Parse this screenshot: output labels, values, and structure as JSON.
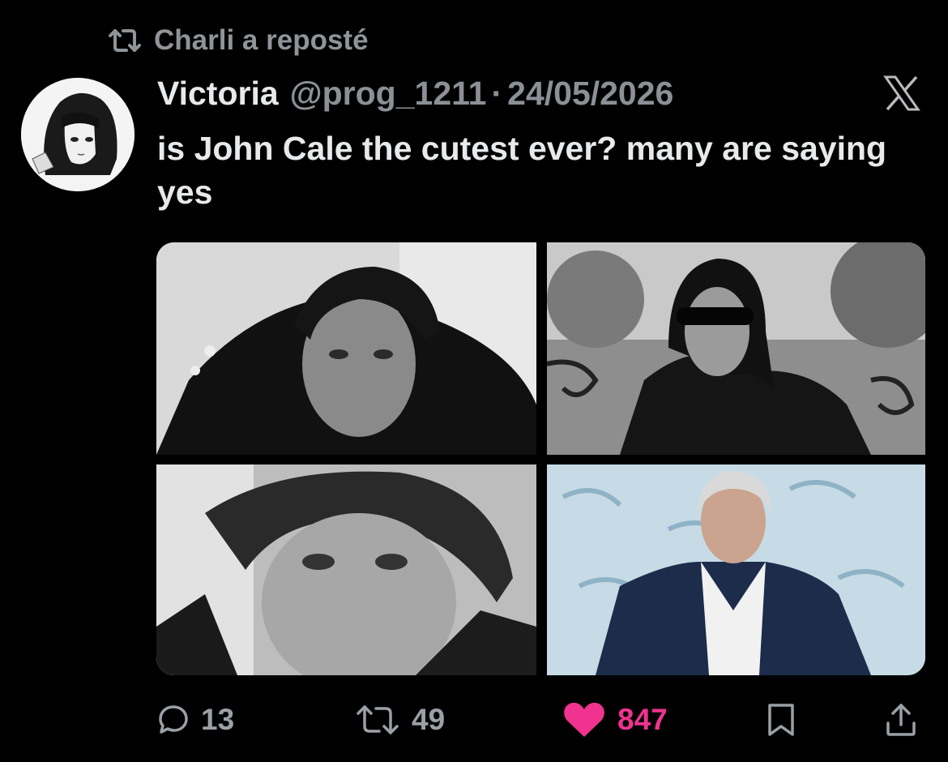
{
  "repost": {
    "icon": "repost-icon",
    "text": "Charli a reposté"
  },
  "tweet": {
    "avatar_icon": "avatar-icon",
    "display_name": "Victoria",
    "handle": "@prog_1211",
    "separator": "·",
    "date": "24/05/2026",
    "platform_icon": "x-logo-icon",
    "text": "is John Cale the cutest ever? many are saying yes",
    "media": [
      {
        "name": "photo-1"
      },
      {
        "name": "photo-2"
      },
      {
        "name": "photo-3"
      },
      {
        "name": "photo-4"
      }
    ]
  },
  "actions": {
    "reply": {
      "icon": "reply-icon",
      "count": "13"
    },
    "repost": {
      "icon": "repost-icon",
      "count": "49"
    },
    "like": {
      "icon": "heart-icon",
      "count": "847",
      "active": true,
      "color": "#f0338f"
    },
    "bookmark": {
      "icon": "bookmark-icon"
    },
    "share": {
      "icon": "share-icon"
    }
  },
  "colors": {
    "background": "#000000",
    "text": "#e7e9ea",
    "muted": "#8b9096",
    "like": "#f0338f"
  }
}
